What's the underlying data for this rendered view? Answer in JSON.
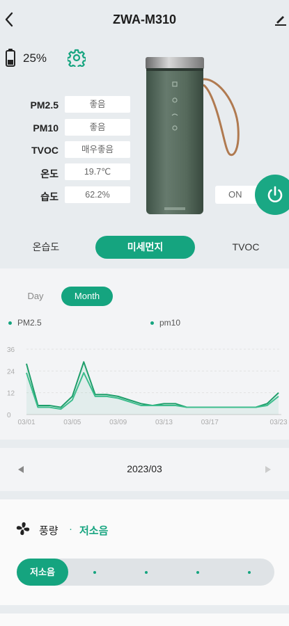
{
  "header": {
    "title": "ZWA-M310",
    "back_icon": "chevron-left-icon",
    "edit_icon": "pencil-icon"
  },
  "status": {
    "battery": "25%",
    "battery_icon": "battery-icon",
    "settings_icon": "gear-icon"
  },
  "readings": [
    {
      "label": "PM2.5",
      "value": "좋음"
    },
    {
      "label": "PM10",
      "value": "좋음"
    },
    {
      "label": "TVOC",
      "value": "매우좋음"
    },
    {
      "label": "온도",
      "value": "19.7℃"
    },
    {
      "label": "습도",
      "value": "62.2%"
    }
  ],
  "power": {
    "state_label": "ON",
    "icon": "power-icon"
  },
  "tabs": [
    {
      "label": "온습도"
    },
    {
      "label": "미세먼지",
      "active": true
    },
    {
      "label": "TVOC"
    }
  ],
  "range_toggle": {
    "day": "Day",
    "month": "Month",
    "selected": "Month"
  },
  "chart_data": {
    "type": "line",
    "x": [
      "03/01",
      "03/02",
      "03/03",
      "03/04",
      "03/05",
      "03/06",
      "03/07",
      "03/08",
      "03/09",
      "03/10",
      "03/11",
      "03/12",
      "03/13",
      "03/14",
      "03/15",
      "03/16",
      "03/17",
      "03/18",
      "03/19",
      "03/20",
      "03/21",
      "03/22",
      "03/23"
    ],
    "xticks": [
      "03/01",
      "03/05",
      "03/09",
      "03/13",
      "03/17",
      "03/23"
    ],
    "ylim": [
      0,
      36
    ],
    "yticks": [
      "0",
      "12",
      "24",
      "36"
    ],
    "series": [
      {
        "name": "PM2.5",
        "color": "#1e9e6a",
        "values": [
          28,
          5,
          5,
          4,
          10,
          29,
          11,
          11,
          10,
          8,
          6,
          5,
          6,
          6,
          4,
          4,
          4,
          4,
          4,
          4,
          4,
          6,
          12
        ]
      },
      {
        "name": "pm10",
        "color": "#3dbd8d",
        "values": [
          23,
          4,
          4,
          3,
          8,
          23,
          10,
          10,
          9,
          7,
          5,
          5,
          5,
          5,
          4,
          4,
          4,
          4,
          4,
          4,
          4,
          5,
          10
        ]
      }
    ],
    "grid": true,
    "legend": "top"
  },
  "month_nav": {
    "label": "2023/03"
  },
  "fan": {
    "label": "풍량",
    "separator": "·",
    "value": "저소음",
    "thumb_label": "저소음",
    "level": 1,
    "levels": 6,
    "icon": "fan-icon"
  },
  "colors": {
    "accent": "#15a47f",
    "background": "#e8ecef"
  }
}
